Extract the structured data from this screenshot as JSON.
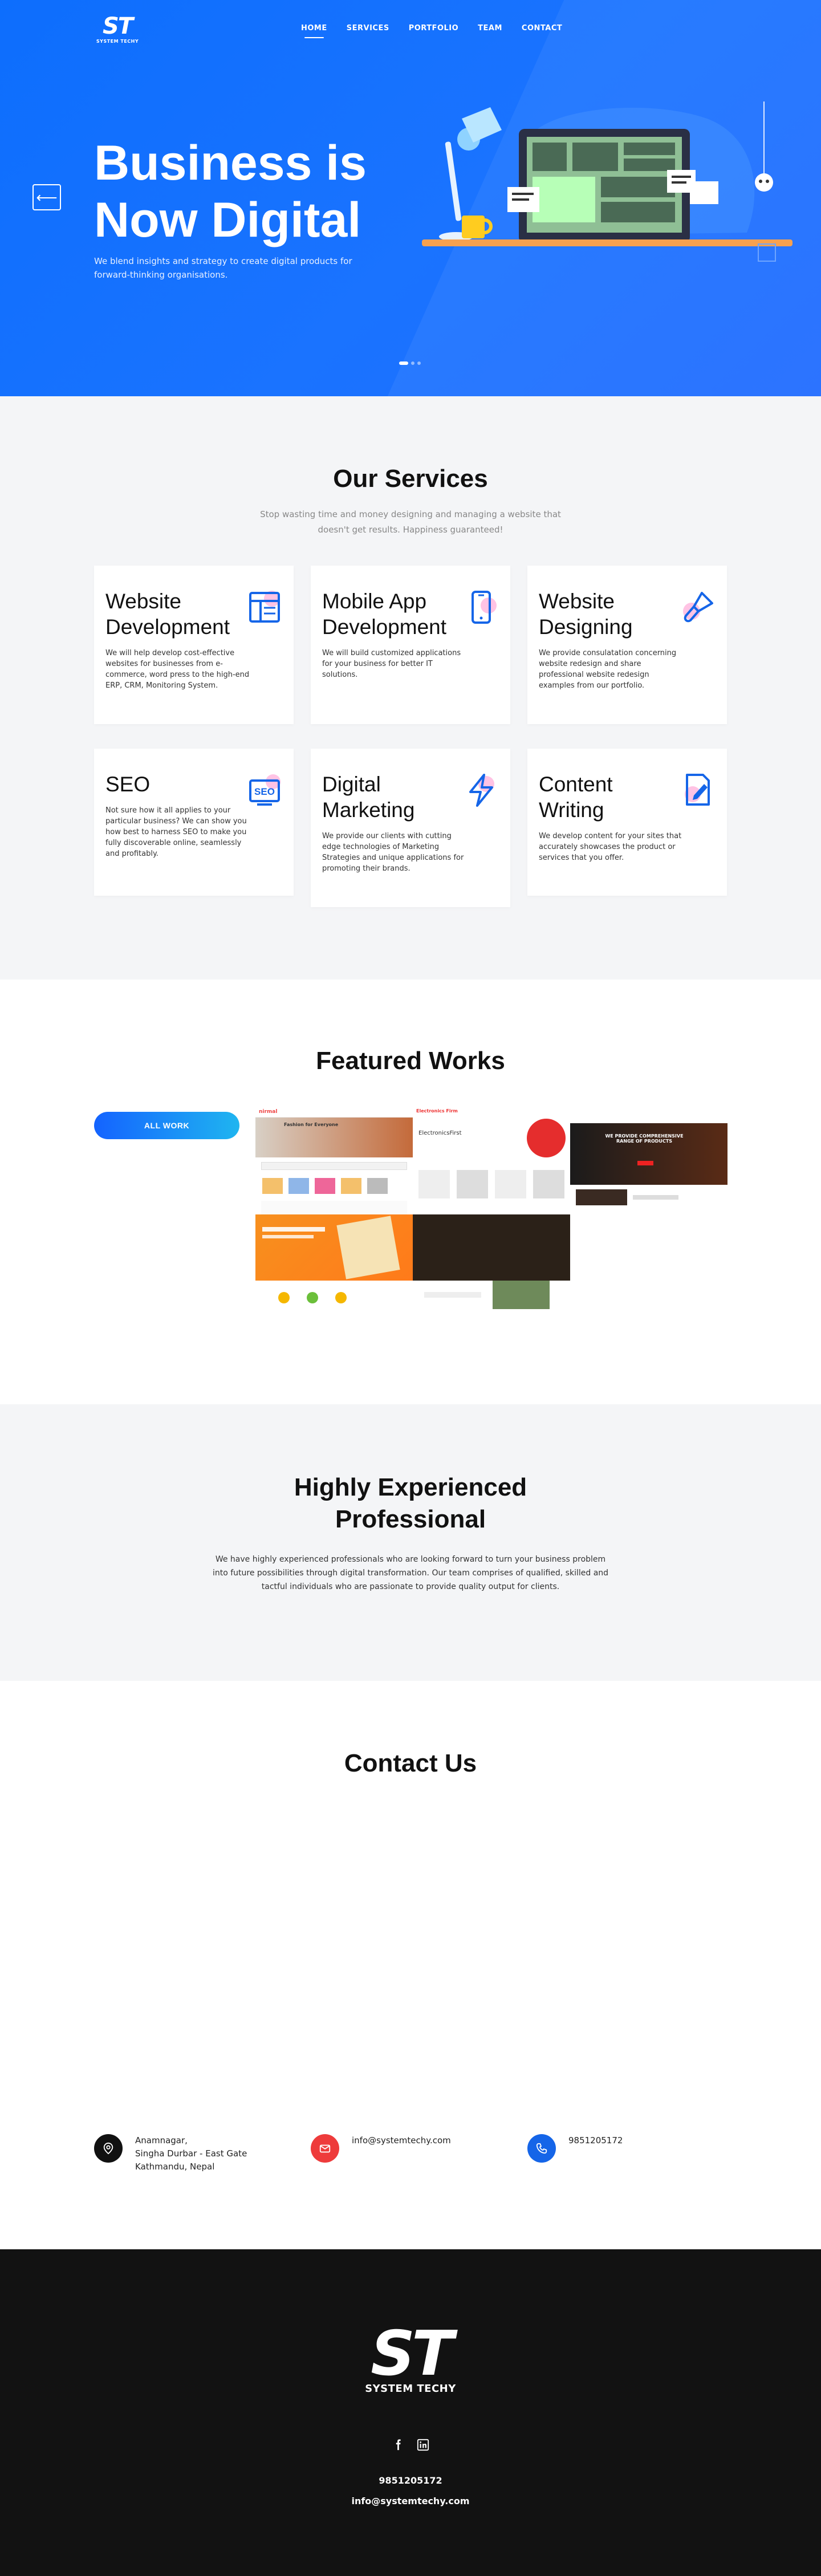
{
  "brand": {
    "mark": "ST",
    "name": "SYSTEM TECHY"
  },
  "nav": {
    "items": [
      {
        "label": "HOME",
        "active": true
      },
      {
        "label": "SERVICES",
        "active": false
      },
      {
        "label": "PORTFOLIO",
        "active": false
      },
      {
        "label": "TEAM",
        "active": false
      },
      {
        "label": "CONTACT",
        "active": false
      }
    ]
  },
  "hero": {
    "title_line1": "Business is",
    "title_line2": "Now Digital",
    "subtitle": "We blend insights and strategy to create digital products for forward-thinking organisations.",
    "prev_icon": "arrow-left-icon",
    "slides": 3,
    "active_slide": 1
  },
  "services": {
    "title": "Our Services",
    "subtitle": "Stop wasting time and money designing and managing a website that doesn't get results. Happiness guaranteed!",
    "items": [
      {
        "title": "Website Development",
        "text": "We will help develop cost-effective websites for businesses from e-commerce, word press to the high-end ERP, CRM, Monitoring System.",
        "icon": "layout-icon"
      },
      {
        "title": "Mobile App Development",
        "text": "We will build customized applications for your business for better IT solutions.",
        "icon": "smartphone-icon"
      },
      {
        "title": "Website Designing",
        "text": "We provide consulatation concerning website redesign and share professional website redesign examples from our portfolio.",
        "icon": "paint-brush-icon"
      },
      {
        "title": "SEO",
        "text": "Not sure how it all applies to your particular business? We can show you how best to harness SEO to make you fully discoverable online, seamlessly and profitably.",
        "icon": "seo-icon"
      },
      {
        "title": "Digital Marketing",
        "text": "We provide our clients with cutting edge technologies of Marketing Strategies and unique applications for promoting their brands.",
        "icon": "lightning-icon"
      },
      {
        "title": "Content Writing",
        "text": "We develop content for your sites that accurately showcases the product or services that you offer.",
        "icon": "document-edit-icon"
      }
    ]
  },
  "works": {
    "title": "Featured Works",
    "button": "ALL WORK",
    "shot1": {
      "brand": "nirmal",
      "slogan": "Fashion for Everyone"
    },
    "shot2": {
      "brand": "Electronics Firm",
      "heading": "ElectronicsFirst"
    },
    "shot3": {
      "heading": "WE PROVIDE COMPREHENSIVE RANGE OF PRODUCTS"
    }
  },
  "experience": {
    "title": "Highly Experienced Professional",
    "text": "We have highly experienced professionals who are looking forward to turn your business problem into future possibilities through digital transformation. Our team comprises of qualified, skilled and tactful individuals who are passionate to provide quality output for clients."
  },
  "contact": {
    "title": "Contact Us",
    "address_line1": "Anamnagar,",
    "address_line2": "Singha Durbar - East Gate",
    "address_line3": "Kathmandu, Nepal",
    "email": "info@systemtechy.com",
    "phone": "9851205172",
    "colors": {
      "address": "#111111",
      "email": "#ee3b3b",
      "phone": "#1565e8"
    }
  },
  "footer": {
    "mark": "ST",
    "name": "SYSTEM TECHY",
    "social": [
      "facebook-icon",
      "linkedin-icon"
    ],
    "phone": "9851205172",
    "email": "info@systemtechy.com"
  },
  "colors": {
    "primary": "#0d6efd",
    "dark": "#121212",
    "light_bg": "#f4f5f7"
  }
}
